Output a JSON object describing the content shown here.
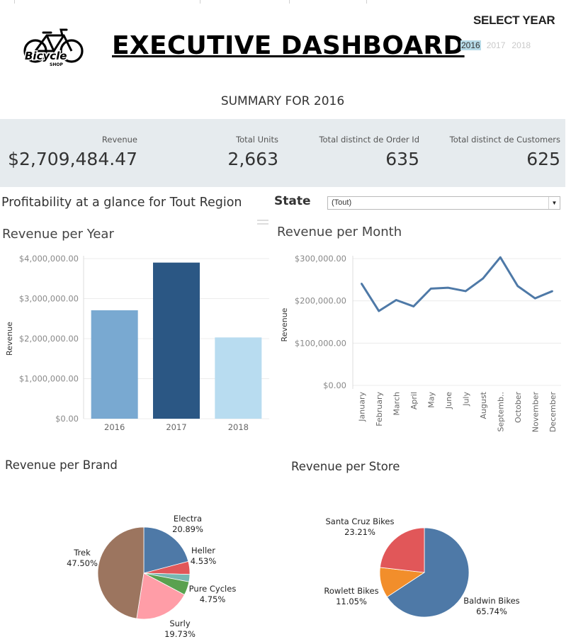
{
  "header": {
    "title": "EXECUTIVE DASHBOARD",
    "logo": {
      "icon": "bicycle-icon",
      "text": "Bicycle",
      "subtext": "SHOP"
    },
    "select_year_label": "SELECT YEAR",
    "years": [
      {
        "label": "2016",
        "selected": true
      },
      {
        "label": "2017",
        "selected": false
      },
      {
        "label": "2018",
        "selected": false
      }
    ]
  },
  "summary_title": "SUMMARY FOR 2016",
  "kpis": [
    {
      "label": "Revenue",
      "value": "$2,709,484.47"
    },
    {
      "label": "Total Units",
      "value": "2,663"
    },
    {
      "label": "Total distinct de Order Id",
      "value": "635"
    },
    {
      "label": "Total distinct de Customers",
      "value": "625"
    }
  ],
  "profitability_title": "Profitability at a glance for Tout Region",
  "state_filter": {
    "label": "State",
    "value": "(Tout)"
  },
  "colors": {
    "kpi_band": "#e6ebee",
    "bar_2016": "#79a9d1",
    "bar_2017": "#2b5784",
    "bar_2018": "#b8dcf0",
    "line": "#4e79a7",
    "year_highlight": "#b7dbe8"
  },
  "chart_data": [
    {
      "type": "bar",
      "title": "Revenue per Year",
      "ylabel": "Revenue",
      "categories": [
        "2016",
        "2017",
        "2018"
      ],
      "values": [
        2709484.47,
        3900000,
        2030000
      ],
      "colors": [
        "#79a9d1",
        "#2b5784",
        "#b8dcf0"
      ],
      "ylim": [
        0,
        4000000
      ],
      "yticks": [
        0,
        1000000,
        2000000,
        3000000,
        4000000
      ],
      "ytick_labels": [
        "$0.00",
        "$1,000,000.00",
        "$2,000,000.00",
        "$3,000,000.00",
        "$4,000,000.00"
      ],
      "grid": true
    },
    {
      "type": "line",
      "title": "Revenue per Month",
      "ylabel": "Revenue",
      "categories": [
        "January",
        "February",
        "March",
        "April",
        "May",
        "June",
        "July",
        "August",
        "Septemb..",
        "October",
        "November",
        "December"
      ],
      "values": [
        241000,
        176000,
        202000,
        187000,
        229000,
        231000,
        223000,
        253000,
        303000,
        235000,
        206000,
        223000
      ],
      "ylim": [
        0,
        300000
      ],
      "yticks": [
        0,
        100000,
        200000,
        300000
      ],
      "ytick_labels": [
        "$0.00",
        "$100,000.00",
        "$200,000.00",
        "$300,000.00"
      ],
      "grid": true
    },
    {
      "type": "pie",
      "title": "Revenue per Brand",
      "slices": [
        {
          "label": "Electra",
          "pct_label": "20.89%",
          "value": 20.89,
          "color": "#4e79a7"
        },
        {
          "label": "Heller",
          "pct_label": "4.53%",
          "value": 4.53,
          "color": "#e15759"
        },
        {
          "label": "",
          "pct_label": "",
          "value": 2.6,
          "color": "#76b7b2"
        },
        {
          "label": "Pure Cycles",
          "pct_label": "4.75%",
          "value": 4.75,
          "color": "#59a14f"
        },
        {
          "label": "Surly",
          "pct_label": "19.73%",
          "value": 19.73,
          "color": "#ff9da7"
        },
        {
          "label": "Trek",
          "pct_label": "47.50%",
          "value": 47.5,
          "color": "#9c755f"
        }
      ]
    },
    {
      "type": "pie",
      "title": "Revenue per Store",
      "slices": [
        {
          "label": "Baldwin Bikes",
          "pct_label": "65.74%",
          "value": 65.74,
          "color": "#4e79a7"
        },
        {
          "label": "Rowlett Bikes",
          "pct_label": "11.05%",
          "value": 11.05,
          "color": "#f28e2b"
        },
        {
          "label": "Santa Cruz Bikes",
          "pct_label": "23.21%",
          "value": 23.21,
          "color": "#e15759"
        }
      ]
    }
  ]
}
